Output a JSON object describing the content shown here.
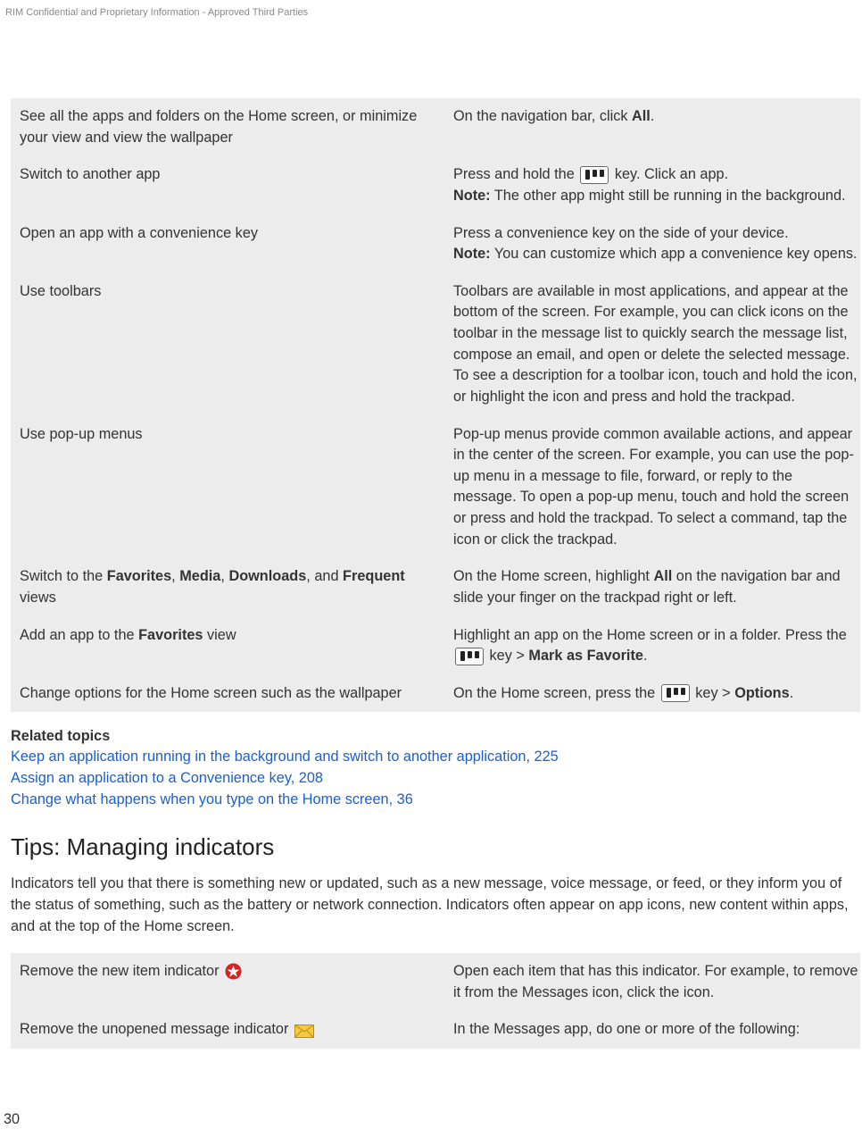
{
  "header_strip": "RIM Confidential and Proprietary Information - Approved Third Parties",
  "table1": {
    "rows": [
      {
        "task": "See all the apps and folders on the Home screen, or minimize your view and view the wallpaper",
        "action_pre": "On the navigation bar, click ",
        "action_bold": "All",
        "action_post": "."
      },
      {
        "task": "Switch to another app",
        "action_line1_pre": "Press and hold the ",
        "action_line1_post": " key. Click an app.",
        "note": "The other app might still be running in the background."
      },
      {
        "task": "Open an app with a convenience key",
        "action_line1": "Press a convenience key on the side of your device.",
        "note": "You can customize which app a convenience key opens."
      },
      {
        "task": "Use toolbars",
        "action": "Toolbars are available in most applications, and appear at the bottom of the screen. For example, you can click icons on the toolbar in the message list to quickly search the message list, compose an email, and open or delete the selected message. To see a description for a toolbar icon, touch and hold the icon, or highlight the icon and press and hold the trackpad."
      },
      {
        "task": "Use pop-up menus",
        "action": "Pop-up menus provide common available actions, and appear in the center of the screen. For example, you can use the pop-up menu in a message to file, forward, or reply to the message. To open a pop-up menu, touch and hold the screen or press and hold the trackpad. To select a command, tap the icon or click the trackpad."
      },
      {
        "task_pre": "Switch to the ",
        "task_b1": "Favorites",
        "task_mid1": ", ",
        "task_b2": "Media",
        "task_mid2": ", ",
        "task_b3": "Downloads",
        "task_mid3": ", and ",
        "task_b4": "Frequent",
        "task_post": " views",
        "action_pre": "On the Home screen, highlight ",
        "action_bold": "All",
        "action_post": " on the navigation bar and slide your finger on the trackpad right or left."
      },
      {
        "task_pre": "Add an app to the ",
        "task_b1": "Favorites",
        "task_post": " view",
        "action_line1": "Highlight an app on the Home screen or in a folder. Press the ",
        "action_key_post": " key > ",
        "action_bold": "Mark as Favorite",
        "action_end": "."
      },
      {
        "task": "Change options for the Home screen such as the wallpaper",
        "action_pre": "On the Home screen, press the ",
        "action_key_post": " key > ",
        "action_bold": "Options",
        "action_end": "."
      }
    ]
  },
  "related": {
    "heading": "Related topics",
    "links": [
      "Keep an application running in the background and switch to another application, 225",
      "Assign an application to a Convenience key, 208",
      "Change what happens when you type on the Home screen, 36"
    ]
  },
  "section2": {
    "title": "Tips: Managing indicators",
    "intro": "Indicators tell you that there is something new or updated, such as a new message, voice message, or feed, or they inform you of the status of something, such as the battery or network connection. Indicators often appear on app icons, new content within apps, and at the top of the Home screen."
  },
  "table2": {
    "rows": [
      {
        "task": "Remove the new item indicator ",
        "action": "Open each item that has this indicator. For example, to remove it from the Messages icon, click the icon."
      },
      {
        "task": "Remove the unopened message indicator ",
        "action": "In the Messages app, do one or more of the following:"
      }
    ]
  },
  "page_number": "30",
  "note_label": "Note:"
}
